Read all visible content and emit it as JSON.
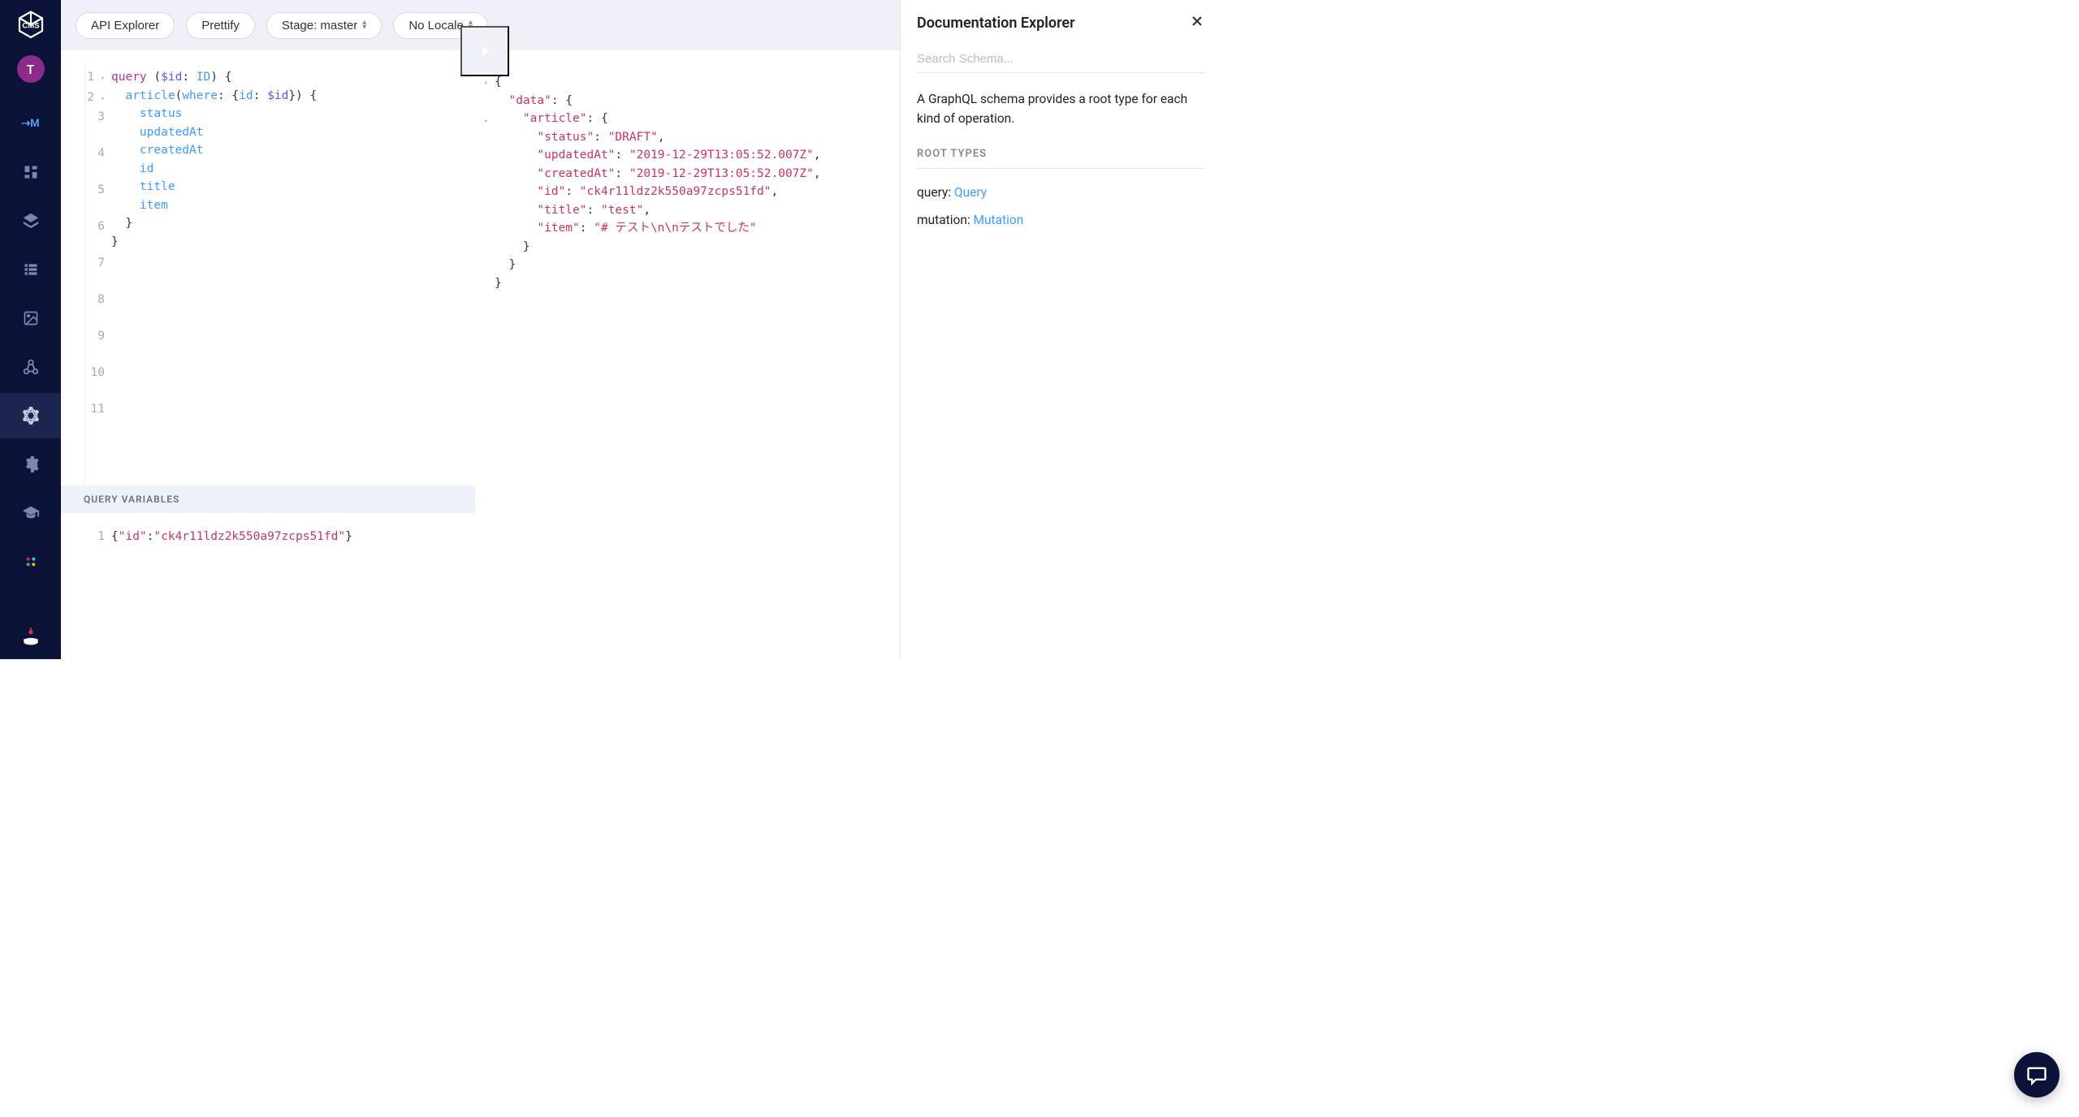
{
  "sidebar": {
    "avatar_initial": "T",
    "m_label": "⇢M"
  },
  "toolbar": {
    "api_explorer": "API Explorer",
    "prettify": "Prettify",
    "stage_label": "Stage: master",
    "locale_label": "No Locale"
  },
  "query": {
    "lines": [
      "1",
      "2",
      "3",
      "4",
      "5",
      "6",
      "7",
      "8",
      "9",
      "10",
      "11"
    ],
    "l1_query": "query",
    "l1_paren_open": " (",
    "l1_var": "$id",
    "l1_colon": ": ",
    "l1_type": "ID",
    "l1_paren_close": ") {",
    "l2_indent": "  ",
    "l2_field": "article",
    "l2_paren": "(",
    "l2_arg": "where",
    "l2_colon": ": {",
    "l2_arg2": "id",
    "l2_colon2": ": ",
    "l2_var": "$id",
    "l2_close": "}) {",
    "l3": "    status",
    "l4": "    updatedAt",
    "l5": "    createdAt",
    "l6": "    id",
    "l7": "    title",
    "l8": "    item",
    "l9": "  }",
    "l10": "}"
  },
  "vars": {
    "header": "QUERY VARIABLES",
    "line_num": "1",
    "open": "{",
    "key": "\"id\"",
    "colon": ":",
    "val": "\"ck4r11ldz2k550a97zcps51fd\"",
    "close": "}"
  },
  "result": {
    "l1": "{",
    "l2_pre": "  ",
    "l2_key": "\"data\"",
    "l2_post": ": {",
    "l3_pre": "    ",
    "l3_key": "\"article\"",
    "l3_post": ": {",
    "l4_pre": "      ",
    "l4_key": "\"status\"",
    "l4_mid": ": ",
    "l4_val": "\"DRAFT\"",
    "l4_post": ",",
    "l5_pre": "      ",
    "l5_key": "\"updatedAt\"",
    "l5_mid": ": ",
    "l5_val": "\"2019-12-29T13:05:52.007Z\"",
    "l5_post": ",",
    "l6_pre": "      ",
    "l6_key": "\"createdAt\"",
    "l6_mid": ": ",
    "l6_val": "\"2019-12-29T13:05:52.007Z\"",
    "l6_post": ",",
    "l7_pre": "      ",
    "l7_key": "\"id\"",
    "l7_mid": ": ",
    "l7_val": "\"ck4r11ldz2k550a97zcps51fd\"",
    "l7_post": ",",
    "l8_pre": "      ",
    "l8_key": "\"title\"",
    "l8_mid": ": ",
    "l8_val": "\"test\"",
    "l8_post": ",",
    "l9_pre": "      ",
    "l9_key": "\"item\"",
    "l9_mid": ": ",
    "l9_val": "\"# テスト\\n\\nテストでした\"",
    "l10": "    }",
    "l11": "  }",
    "l12": "}"
  },
  "docs": {
    "title": "Documentation Explorer",
    "search_placeholder": "Search Schema...",
    "description": "A GraphQL schema provides a root type for each kind of operation.",
    "section_title": "ROOT TYPES",
    "query_label": "query: ",
    "query_type": "Query",
    "mutation_label": "mutation: ",
    "mutation_type": "Mutation"
  }
}
